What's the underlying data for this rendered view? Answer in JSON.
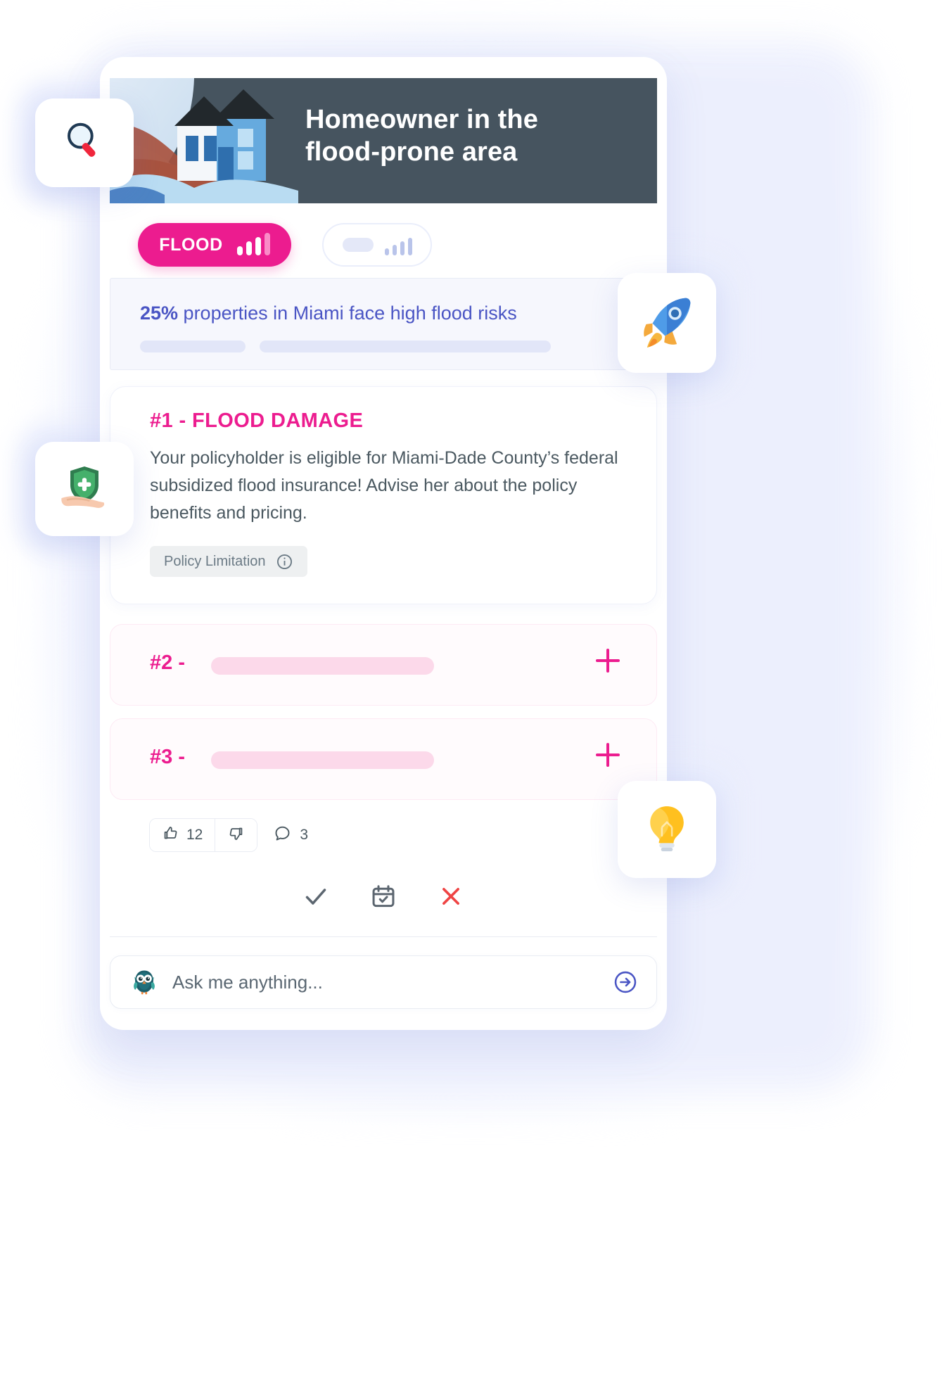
{
  "app": {
    "hero": {
      "title_line1": "Homeowner in the",
      "title_line2": "flood-prone area",
      "background_color": "#46545f",
      "illustration_name": "house-in-flood-illustration"
    },
    "tabs": [
      {
        "label": "FLOOD",
        "active": true,
        "icon": "signal-bars-icon",
        "color": "#ec1c8f"
      },
      {
        "label": "",
        "active": false,
        "icon": "signal-bars-icon",
        "color": "#e4e8f8"
      }
    ],
    "risk_banner": {
      "highlight": "25%",
      "text": " properties in Miami face high flood risks",
      "text_color": "#4a55c4",
      "skeleton_bars": 2
    },
    "insights": [
      {
        "number": "#1",
        "separator": "-",
        "title": "#1 - FLOOD DAMAGE",
        "body": "Your policyholder is eligible for Miami-Dade County’s federal subsidized flood insurance! Advise her about the policy benefits and pricing.",
        "chip_label": "Policy Limitation",
        "chip_icon": "info-circle-icon",
        "expanded": true
      },
      {
        "number": "#2",
        "separator": "-",
        "title": "#2 - ",
        "expanded": false,
        "expand_icon": "plus-icon"
      },
      {
        "number": "#3",
        "separator": "-",
        "title": "#3 - ",
        "expanded": false,
        "expand_icon": "plus-icon"
      }
    ],
    "reactions": {
      "thumbs_up_icon": "thumbs-up-icon",
      "thumbs_up_count": "12",
      "thumbs_down_icon": "thumbs-down-icon",
      "thumbs_down_count": "",
      "comment_icon": "comment-bubble-icon",
      "comment_count": "3"
    },
    "actions": [
      {
        "name": "accept",
        "icon": "check-icon",
        "color": "#5c6670"
      },
      {
        "name": "schedule",
        "icon": "calendar-check-icon",
        "color": "#5c6670"
      },
      {
        "name": "dismiss",
        "icon": "close-x-icon",
        "color": "#ef4444"
      }
    ],
    "ask_bar": {
      "avatar_icon": "owl-mascot-icon",
      "placeholder": "Ask me anything...",
      "value": "",
      "send_icon": "arrow-right-circle-icon"
    },
    "floating_badges": [
      {
        "name": "search-badge",
        "icon": "magnifier-icon"
      },
      {
        "name": "rocket-badge",
        "icon": "rocket-icon"
      },
      {
        "name": "shield-badge",
        "icon": "shield-in-hand-icon"
      },
      {
        "name": "lightbulb-badge",
        "icon": "lightbulb-icon"
      }
    ],
    "colors": {
      "accent_pink": "#ec1c8f",
      "banner_dark": "#46545f",
      "risk_blue": "#4a55c4",
      "body_text": "#4a5860"
    }
  }
}
